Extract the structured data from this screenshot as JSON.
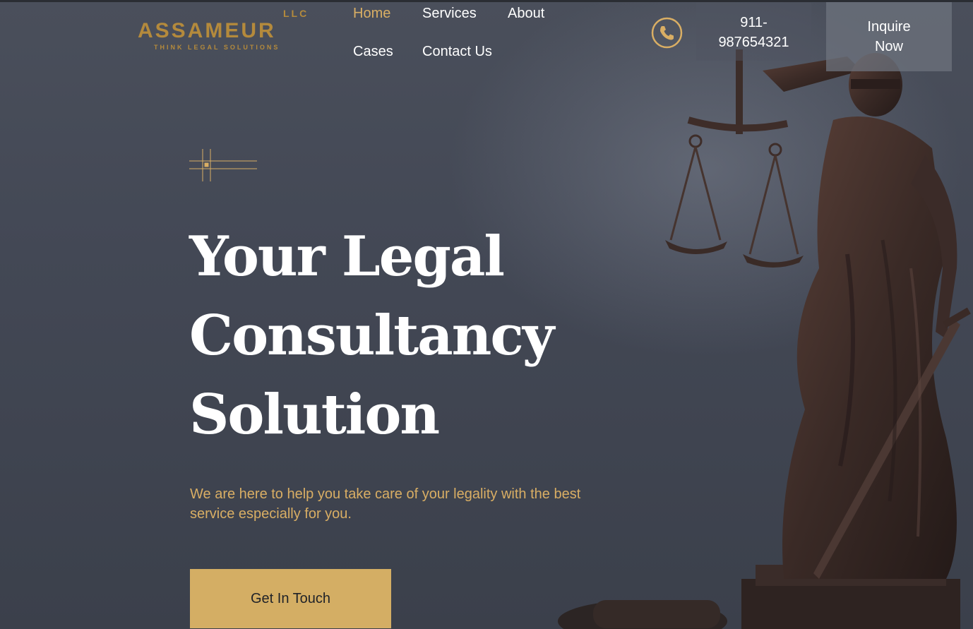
{
  "brand": {
    "suffix": "LLC",
    "name": "ASSAMEUR",
    "tagline": "THINK LEGAL SOLUTIONS",
    "color": "#b48a3c"
  },
  "nav": {
    "items": [
      {
        "label": "Home",
        "active": true
      },
      {
        "label": "Services",
        "active": false
      },
      {
        "label": "About",
        "active": false
      },
      {
        "label": "Cases",
        "active": false
      },
      {
        "label": "Contact Us",
        "active": false
      }
    ]
  },
  "contact": {
    "icon": "phone-icon",
    "phone_line1": "911-",
    "phone_line2": "987654321"
  },
  "header_cta": {
    "line1": "Inquire",
    "line2": "Now"
  },
  "hero": {
    "title_lines": [
      "Your Legal",
      "Consultancy",
      "Solution"
    ],
    "subtitle": "We are here to help you take care of your legality with the best service especially for you.",
    "button_label": "Get In Touch",
    "ornament_icon": "crosshair-ornament-icon",
    "background_image": "lady-justice-statue-image"
  },
  "colors": {
    "accent": "#d9ae64",
    "button": "#d4ae64",
    "background": "#3f4450",
    "text": "#ffffff"
  }
}
